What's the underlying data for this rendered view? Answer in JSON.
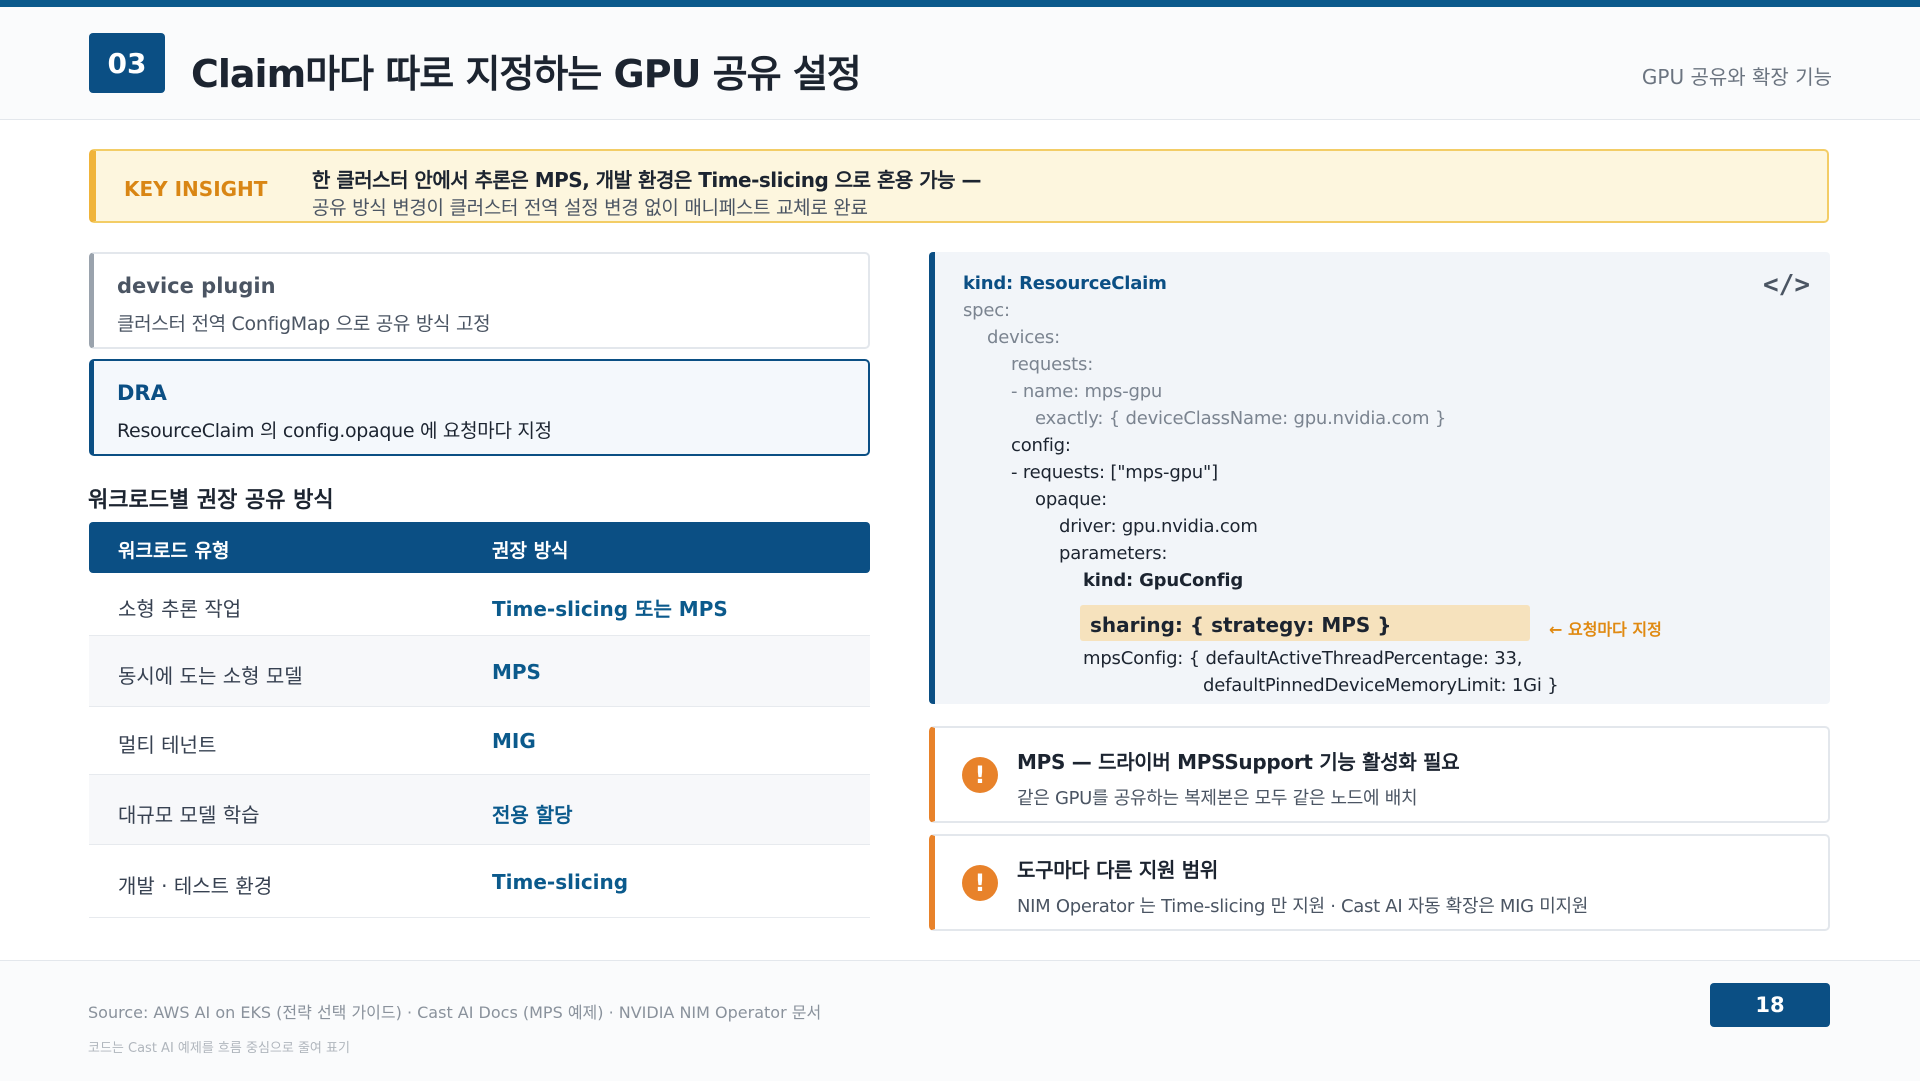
{
  "header": {
    "section_number": "03",
    "title": "Claim마다 따로 지정하는 GPU 공유 설정",
    "section_name": "GPU 공유와 확장 기능"
  },
  "insight": {
    "label": "KEY INSIGHT",
    "main": "한 클러스터 안에서 추론은 MPS, 개발 환경은 Time-slicing 으로 혼용 가능 —",
    "sub": "공유 방식 변경이 클러스터 전역 설정 변경 없이 매니페스트 교체로 완료"
  },
  "options": [
    {
      "title": "device plugin",
      "desc": "클러스터 전역 ConfigMap 으로 공유 방식 고정"
    },
    {
      "title": "DRA",
      "desc": "ResourceClaim 의 config.opaque 에 요청마다 지정"
    }
  ],
  "table": {
    "title": "워크로드별 권장 공유 방식",
    "headers": [
      "워크로드 유형",
      "권장 방식"
    ],
    "rows": [
      [
        "소형 추론 작업",
        "Time-slicing 또는 MPS"
      ],
      [
        "동시에 도는 소형 모델",
        "MPS"
      ],
      [
        "멀티 테넌트",
        "MIG"
      ],
      [
        "대규모 모델 학습",
        "전용 할당"
      ],
      [
        "개발 · 테스트 환경",
        "Time-slicing"
      ]
    ]
  },
  "code": {
    "icon": "code-icon",
    "lines": [
      "kind: ResourceClaim",
      "spec:",
      "devices:",
      "requests:",
      "- name: mps-gpu",
      "exactly: { deviceClassName: gpu.nvidia.com }",
      "config:",
      "- requests: [\"mps-gpu\"]",
      "opaque:",
      "driver: gpu.nvidia.com",
      "parameters:",
      "kind: GpuConfig",
      "sharing: { strategy: MPS }",
      "mpsConfig: { defaultActiveThreadPercentage: 33,",
      "defaultPinnedDeviceMemoryLimit: 1Gi }"
    ],
    "highlight_note": "← 요청마다 지정"
  },
  "warnings": [
    {
      "icon": "warning-icon",
      "title": "MPS — 드라이버 MPSSupport 기능 활성화 필요",
      "desc": "같은 GPU를 공유하는 복제본은 모두 같은 노드에 배치"
    },
    {
      "icon": "warning-icon",
      "title": "도구마다 다른 지원 범위",
      "desc": "NIM Operator 는 Time-slicing 만 지원 · Cast AI 자동 확장은 MIG 미지원"
    }
  ],
  "footer": {
    "source": "Source: AWS AI on EKS (전략 선택 가이드) · Cast AI Docs (MPS 예제) · NVIDIA NIM Operator 문서",
    "note": "코드는 Cast AI 예제를 흐름 중심으로 줄여 표기",
    "page_number": "18"
  },
  "colors": {
    "primary": "#0b4f84",
    "insight_accent": "#f0b43a",
    "warning": "#e8822a",
    "highlight": "#f6e2bd"
  }
}
